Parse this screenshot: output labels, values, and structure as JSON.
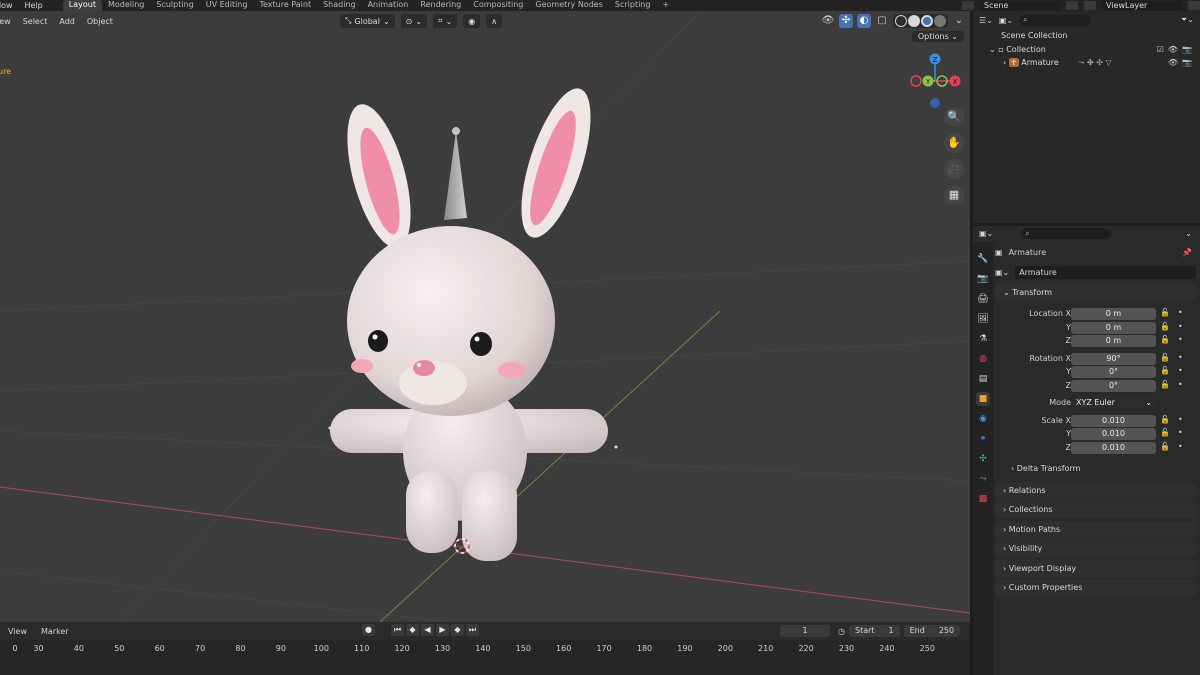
{
  "topbar": {
    "menus": [
      "dow",
      "Help"
    ],
    "tabs": [
      {
        "label": "Layout",
        "active": true
      },
      {
        "label": "Modeling"
      },
      {
        "label": "Sculpting"
      },
      {
        "label": "UV Editing"
      },
      {
        "label": "Texture Paint"
      },
      {
        "label": "Shading"
      },
      {
        "label": "Animation"
      },
      {
        "label": "Rendering"
      },
      {
        "label": "Compositing"
      },
      {
        "label": "Geometry Nodes"
      },
      {
        "label": "Scripting"
      }
    ],
    "add_tab": "+",
    "scene": "Scene",
    "view_layer": "ViewLayer"
  },
  "viewport": {
    "menus": [
      "iew",
      "Select",
      "Add",
      "Object"
    ],
    "orientation": "Global",
    "options_label": "Options",
    "active_object_label": "ure",
    "gizmo": {
      "z": "Z",
      "x": "X",
      "y": "Y"
    }
  },
  "timeline": {
    "menus": [
      "View",
      "Marker"
    ],
    "current_frame": "1",
    "start_label": "Start",
    "start_value": "1",
    "end_label": "End",
    "end_value": "250",
    "ruler": [
      "0",
      "30",
      "40",
      "50",
      "60",
      "70",
      "80",
      "90",
      "100",
      "110",
      "120",
      "130",
      "140",
      "150",
      "160",
      "170",
      "180",
      "190",
      "200",
      "210",
      "220",
      "230",
      "240",
      "250"
    ]
  },
  "outliner": {
    "scene_collection": "Scene Collection",
    "collection": "Collection",
    "armature": "Armature"
  },
  "properties": {
    "object_name": "Armature",
    "data_name": "Armature",
    "transform_label": "Transform",
    "location": {
      "label_x": "Location X",
      "label_y": "Y",
      "label_z": "Z",
      "x": "0 m",
      "y": "0 m",
      "z": "0 m"
    },
    "rotation": {
      "label_x": "Rotation X",
      "label_y": "Y",
      "label_z": "Z",
      "x": "90°",
      "y": "0°",
      "z": "0°"
    },
    "mode_label": "Mode",
    "mode_value": "XYZ Euler",
    "scale": {
      "label_x": "Scale X",
      "label_y": "Y",
      "label_z": "Z",
      "x": "0.010",
      "y": "0.010",
      "z": "0.010"
    },
    "delta_transform": "Delta Transform",
    "panels": [
      "Relations",
      "Collections",
      "Motion Paths",
      "Visibility",
      "Viewport Display",
      "Custom Properties"
    ]
  },
  "colors": {
    "viewport_bg": "#3c3c3c",
    "accent_blue": "#4772b3",
    "x_axis": "#e0435a",
    "y_axis": "#8bc34a",
    "z_axis": "#3b8ee8",
    "active_object": "#f2b233"
  }
}
